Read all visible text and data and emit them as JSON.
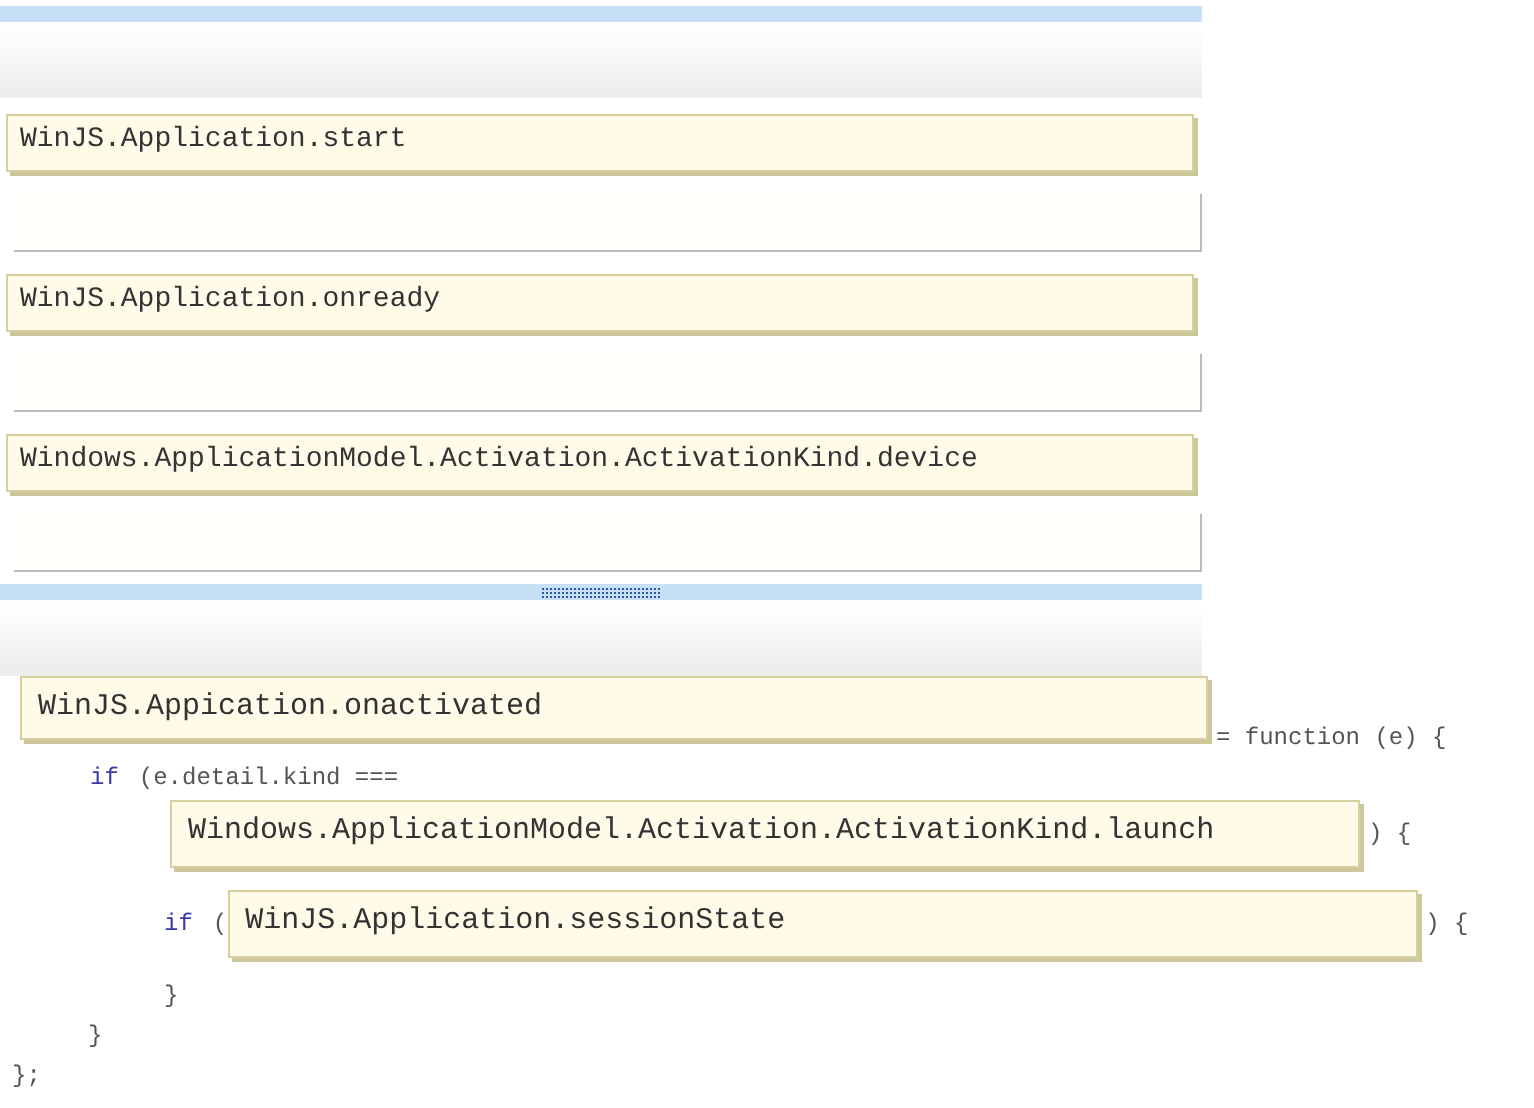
{
  "answer_choices": [
    {
      "text": "WinJS.Application.start"
    },
    {
      "text": "WinJS.Application.onready"
    },
    {
      "text": "Windows.ApplicationModel.Activation.ActivationKind.device"
    }
  ],
  "code_lines": [
    {
      "parts": [
        {
          "kind": "slot",
          "text": "WinJS.Appication.onactivated"
        },
        {
          "kind": "code",
          "text": "= function (e) {"
        }
      ]
    },
    {
      "parts": [
        {
          "kind": "keyword",
          "text": "if"
        },
        {
          "kind": "code",
          "text": "(e.detail.kind ==="
        }
      ]
    },
    {
      "parts": [
        {
          "kind": "slot",
          "text": "Windows.ApplicationModel.Activation.ActivationKind.launch"
        },
        {
          "kind": "code",
          "text": ") {"
        }
      ]
    },
    {
      "parts": [
        {
          "kind": "keyword",
          "text": "if"
        },
        {
          "kind": "code",
          "text": "("
        },
        {
          "kind": "slot",
          "text": "WinJS.Application.sessionState"
        },
        {
          "kind": "code",
          "text": ") {"
        }
      ]
    },
    {
      "parts": [
        {
          "kind": "code",
          "text": "}"
        }
      ]
    },
    {
      "parts": [
        {
          "kind": "code",
          "text": "}"
        }
      ]
    },
    {
      "parts": [
        {
          "kind": "code",
          "text": "};"
        }
      ]
    }
  ]
}
